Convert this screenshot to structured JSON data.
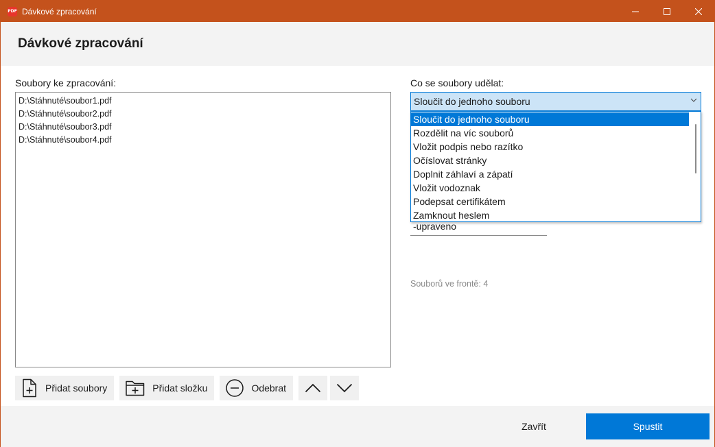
{
  "window": {
    "title": "Dávkové zpracování",
    "app_icon_text": "PDF"
  },
  "header": {
    "title": "Dávkové zpracování"
  },
  "files": {
    "label": "Soubory ke zpracování:",
    "items": [
      "D:\\Stáhnuté\\soubor1.pdf",
      "D:\\Stáhnuté\\soubor2.pdf",
      "D:\\Stáhnuté\\soubor3.pdf",
      "D:\\Stáhnuté\\soubor4.pdf"
    ]
  },
  "toolbar": {
    "add_files": "Přidat soubory",
    "add_folder": "Přidat složku",
    "remove": "Odebrat"
  },
  "action": {
    "label": "Co se soubory udělat:",
    "selected": "Sloučit do jednoho souboru",
    "options": [
      "Sloučit do jednoho souboru",
      "Rozdělit na víc souborů",
      "Vložit podpis nebo razítko",
      "Očíslovat stránky",
      "Doplnit záhlaví a zápatí",
      "Vložit vodoznak",
      "Podepsat certifikátem",
      "Zamknout heslem"
    ],
    "selected_index": 0
  },
  "suffix_field": {
    "value": "-upraveno"
  },
  "status": {
    "queue": "Souborů ve frontě: 4"
  },
  "footer": {
    "close": "Zavřít",
    "run": "Spustit"
  },
  "colors": {
    "titlebar": "#c4521c",
    "accent": "#0078d7",
    "combo_bg": "#cce4f7",
    "panel_bg": "#f3f3f3",
    "button_bg": "#f0f0f0"
  }
}
